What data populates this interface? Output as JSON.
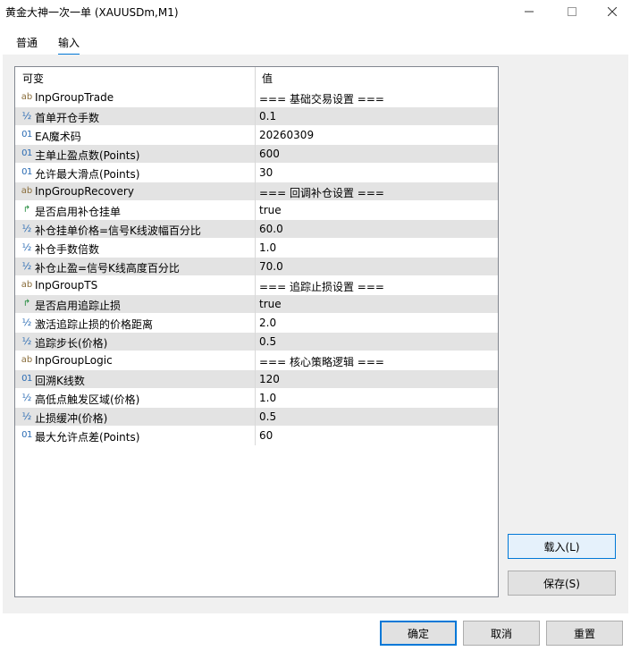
{
  "window": {
    "title": "黄金大神一次一单 (XAUUSDm,M1)"
  },
  "tabs": [
    {
      "label": "普通"
    },
    {
      "label": "输入"
    }
  ],
  "grid": {
    "columns": [
      "可变",
      "值"
    ],
    "rows": [
      {
        "icon": "ab-icon",
        "glyph": "ab",
        "name": "InpGroupTrade",
        "value": "=== 基础交易设置 ==="
      },
      {
        "icon": "fraction-icon",
        "glyph": "½",
        "name": "首单开仓手数",
        "value": "0.1"
      },
      {
        "icon": "integer-icon",
        "glyph": "01",
        "name": "EA魔术码",
        "value": "20260309"
      },
      {
        "icon": "integer-icon",
        "glyph": "01",
        "name": "主单止盈点数(Points)",
        "value": "600"
      },
      {
        "icon": "integer-icon",
        "glyph": "01",
        "name": "允许最大滑点(Points)",
        "value": "30"
      },
      {
        "icon": "ab-icon",
        "glyph": "ab",
        "name": "InpGroupRecovery",
        "value": "=== 回调补仓设置 ==="
      },
      {
        "icon": "bool-arrow-icon",
        "glyph": "↱",
        "name": "是否启用补仓挂单",
        "value": "true"
      },
      {
        "icon": "fraction-icon",
        "glyph": "½",
        "name": "补仓挂单价格=信号K线波幅百分比",
        "value": "60.0"
      },
      {
        "icon": "fraction-icon",
        "glyph": "½",
        "name": "补仓手数倍数",
        "value": "1.0"
      },
      {
        "icon": "fraction-icon",
        "glyph": "½",
        "name": "补仓止盈=信号K线高度百分比",
        "value": "70.0"
      },
      {
        "icon": "ab-icon",
        "glyph": "ab",
        "name": "InpGroupTS",
        "value": "=== 追踪止损设置 ==="
      },
      {
        "icon": "bool-arrow-icon",
        "glyph": "↱",
        "name": "是否启用追踪止损",
        "value": "true"
      },
      {
        "icon": "fraction-icon",
        "glyph": "½",
        "name": "激活追踪止损的价格距离",
        "value": "2.0"
      },
      {
        "icon": "fraction-icon",
        "glyph": "½",
        "name": "追踪步长(价格)",
        "value": "0.5"
      },
      {
        "icon": "ab-icon",
        "glyph": "ab",
        "name": "InpGroupLogic",
        "value": "=== 核心策略逻辑 ==="
      },
      {
        "icon": "integer-icon",
        "glyph": "01",
        "name": "回溯K线数",
        "value": "120"
      },
      {
        "icon": "fraction-icon",
        "glyph": "½",
        "name": "高低点触发区域(价格)",
        "value": "1.0"
      },
      {
        "icon": "fraction-icon",
        "glyph": "½",
        "name": "止损缓冲(价格)",
        "value": "0.5"
      },
      {
        "icon": "integer-icon",
        "glyph": "01",
        "name": "最大允许点差(Points)",
        "value": "60"
      }
    ]
  },
  "side_buttons": {
    "load": "载入(L)",
    "save": "保存(S)"
  },
  "footer_buttons": {
    "ok": "确定",
    "cancel": "取消",
    "reset": "重置"
  }
}
